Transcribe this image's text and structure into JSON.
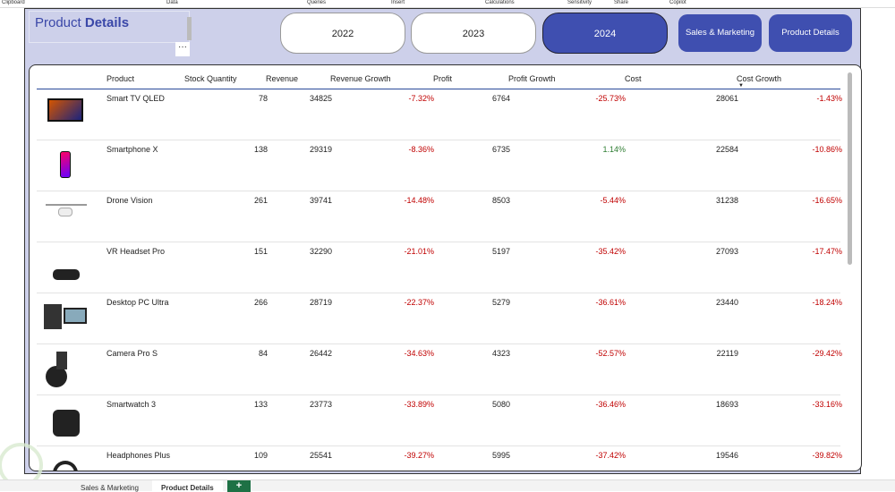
{
  "ribbon": [
    "Clipboard",
    "Data",
    "Queries",
    "Insert",
    "Calculations",
    "Sensitivity",
    "Share",
    "Copilot"
  ],
  "header": {
    "title_light": "Product",
    "title_bold": "Details",
    "more": "···"
  },
  "years": [
    {
      "label": "2022",
      "active": false
    },
    {
      "label": "2023",
      "active": false
    },
    {
      "label": "2024",
      "active": true
    }
  ],
  "nav": {
    "sales": "Sales & Marketing",
    "product": "Product Details"
  },
  "columns": [
    "Product",
    "Stock Quantity",
    "Revenue",
    "Revenue Growth",
    "Profit",
    "Profit Growth",
    "Cost",
    "Cost Growth"
  ],
  "rows": [
    {
      "icon": "tv-icon",
      "product": "Smart TV QLED",
      "stock": "78",
      "revenue": "34825",
      "rev_growth": "-7.32%",
      "profit": "6764",
      "profit_growth": "-25.73%",
      "cost": "28061",
      "cost_growth": "-1.43%"
    },
    {
      "icon": "smartphone-icon",
      "product": "Smartphone X",
      "stock": "138",
      "revenue": "29319",
      "rev_growth": "-8.36%",
      "profit": "6735",
      "profit_growth": "1.14%",
      "cost": "22584",
      "cost_growth": "-10.86%"
    },
    {
      "icon": "drone-icon",
      "product": "Drone Vision",
      "stock": "261",
      "revenue": "39741",
      "rev_growth": "-14.48%",
      "profit": "8503",
      "profit_growth": "-5.44%",
      "cost": "31238",
      "cost_growth": "-16.65%"
    },
    {
      "icon": "vr-headset-icon",
      "product": "VR Headset Pro",
      "stock": "151",
      "revenue": "32290",
      "rev_growth": "-21.01%",
      "profit": "5197",
      "profit_growth": "-35.42%",
      "cost": "27093",
      "cost_growth": "-17.47%"
    },
    {
      "icon": "desktop-pc-icon",
      "product": "Desktop PC Ultra",
      "stock": "266",
      "revenue": "28719",
      "rev_growth": "-22.37%",
      "profit": "5279",
      "profit_growth": "-36.61%",
      "cost": "23440",
      "cost_growth": "-18.24%"
    },
    {
      "icon": "camera-icon",
      "product": "Camera Pro S",
      "stock": "84",
      "revenue": "26442",
      "rev_growth": "-34.63%",
      "profit": "4323",
      "profit_growth": "-52.57%",
      "cost": "22119",
      "cost_growth": "-29.42%"
    },
    {
      "icon": "smartwatch-icon",
      "product": "Smartwatch 3",
      "stock": "133",
      "revenue": "23773",
      "rev_growth": "-33.89%",
      "profit": "5080",
      "profit_growth": "-36.46%",
      "cost": "18693",
      "cost_growth": "-33.16%"
    },
    {
      "icon": "headphones-icon",
      "product": "Headphones Plus",
      "stock": "109",
      "revenue": "25541",
      "rev_growth": "-39.27%",
      "profit": "5995",
      "profit_growth": "-37.42%",
      "cost": "19546",
      "cost_growth": "-39.82%"
    }
  ],
  "sheet_tabs": [
    {
      "label": "Sales & Marketing"
    },
    {
      "label": "Product Details",
      "active": true
    }
  ],
  "add_tab": "+"
}
